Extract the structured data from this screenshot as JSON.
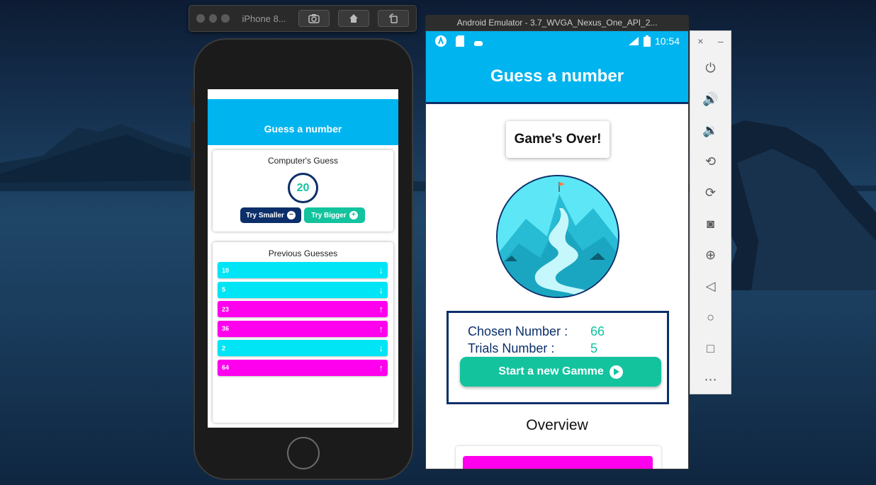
{
  "ios_sim": {
    "device_title": "iPhone 8...",
    "header_title": "Guess a number",
    "guess_card": {
      "title": "Computer's Guess",
      "current_guess": "20",
      "smaller_label": "Try Smaller",
      "bigger_label": "Try Bigger"
    },
    "history_card": {
      "title": "Previous Guesses",
      "items": [
        {
          "value": "10",
          "direction": "down",
          "color": "#00e5f5"
        },
        {
          "value": "5",
          "direction": "down",
          "color": "#00e5f5"
        },
        {
          "value": "23",
          "direction": "up",
          "color": "#ff00ee"
        },
        {
          "value": "36",
          "direction": "up",
          "color": "#ff00ee"
        },
        {
          "value": "2",
          "direction": "down",
          "color": "#00e5f5"
        },
        {
          "value": "64",
          "direction": "up",
          "color": "#ff00ee"
        }
      ]
    }
  },
  "android_emu": {
    "window_title": "Android Emulator - 3.7_WVGA_Nexus_One_API_2...",
    "status_time": "10:54",
    "header_title": "Guess a number",
    "gameover_text": "Game's Over!",
    "chosen_label": "Chosen Number :",
    "chosen_value": "66",
    "trials_label": "Trials Number :",
    "trials_value": "5",
    "start_label": "Start a new Gamme",
    "overview_title": "Overview"
  },
  "colors": {
    "primary": "#00b4ef",
    "accent": "#12c39e",
    "navy": "#0b2f6a",
    "magenta": "#ff00ee",
    "cyan": "#00e5f5"
  },
  "icons": {
    "side_panel": [
      "power-icon",
      "volume-up-icon",
      "volume-down-icon",
      "rotate-left-icon",
      "rotate-right-icon",
      "camera-icon",
      "zoom-icon",
      "back-icon",
      "home-icon",
      "overview-icon",
      "more-icon"
    ]
  }
}
